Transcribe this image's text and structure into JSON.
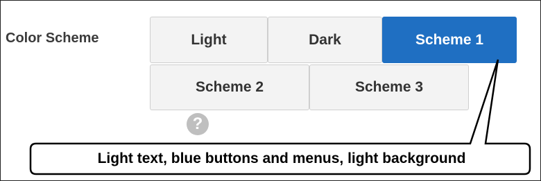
{
  "color_scheme": {
    "label": "Color Scheme",
    "options": [
      {
        "label": "Light",
        "active": false
      },
      {
        "label": "Dark",
        "active": false
      },
      {
        "label": "Scheme 1",
        "active": true
      },
      {
        "label": "Scheme 2",
        "active": false
      },
      {
        "label": "Scheme 3",
        "active": false
      }
    ],
    "help_glyph": "?",
    "help_icon": "question-circle-icon"
  },
  "callout": {
    "text": "Light text, blue buttons and menus, light background"
  },
  "colors": {
    "active_accent": "#1f6fc2",
    "button_bg": "#f3f3f3",
    "help_icon": "#bfbfbf"
  }
}
